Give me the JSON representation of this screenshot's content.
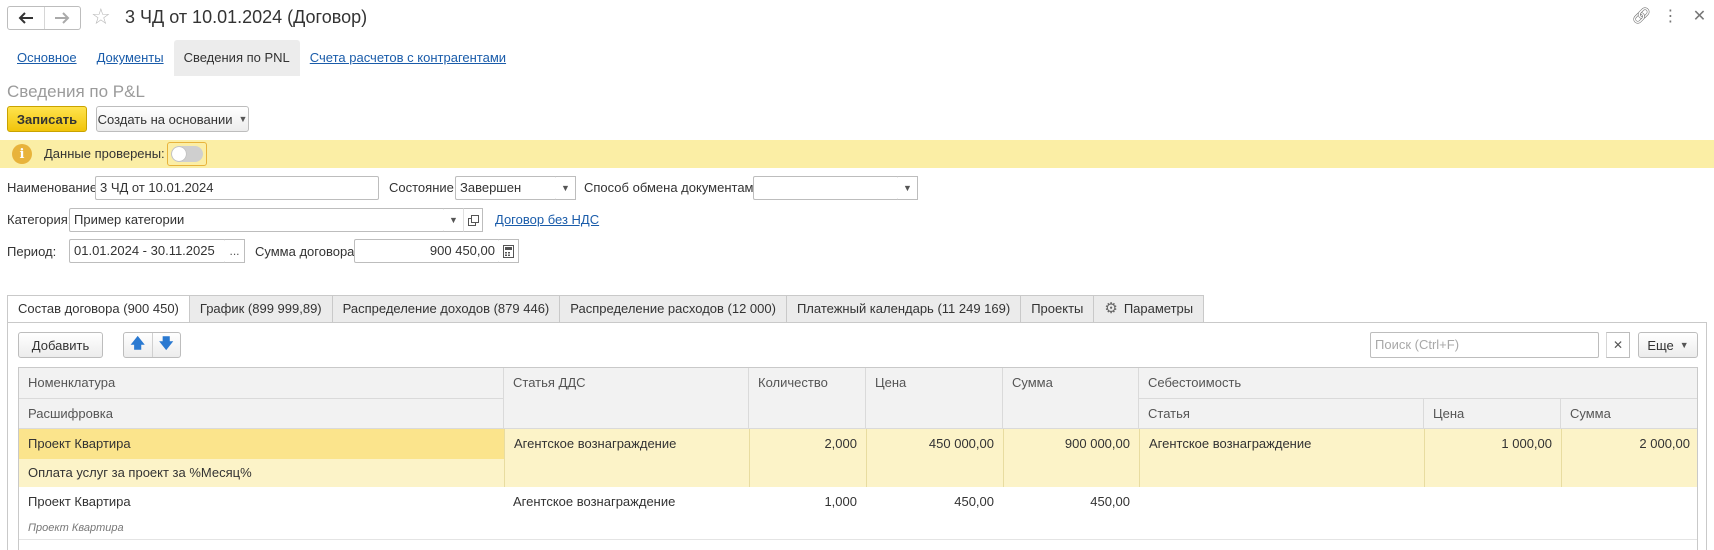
{
  "window": {
    "title": "3 ЧД от 10.01.2024 (Договор)"
  },
  "subtabs": [
    "Основное",
    "Документы",
    "Сведения по PNL",
    "Счета расчетов с контрагентами"
  ],
  "section_title": "Сведения по P&L",
  "toolbar": {
    "save_label": "Записать",
    "create_based_label": "Создать на основании"
  },
  "info": {
    "label": "Данные проверены:",
    "checked": false
  },
  "form": {
    "name_label": "Наименование:",
    "name_value": "3 ЧД от 10.01.2024",
    "state_label": "Состояние:",
    "state_value": "Завершен",
    "exchange_label": "Способ обмена документами:",
    "exchange_value": "",
    "category_label": "Категория:",
    "category_value": "Пример категории",
    "vat_link": "Договор без НДС",
    "period_label": "Период:",
    "period_value": "01.01.2024 - 30.11.2025",
    "period_btn": "...",
    "sum_label": "Сумма договора:",
    "sum_value": "900 450,00"
  },
  "tabs": [
    "Состав договора (900 450)",
    "График (899 999,89)",
    "Распределение доходов (879 446)",
    "Распределение расходов (12 000)",
    "Платежный календарь (11 249 169)",
    "Проекты",
    "Параметры"
  ],
  "table_toolbar": {
    "add_label": "Добавить",
    "search_placeholder": "Поиск (Ctrl+F)",
    "more_label": "Еще"
  },
  "table": {
    "headers": {
      "nomenclature": "Номенклатура",
      "decoding": "Расшифровка",
      "dds": "Статья ДДС",
      "qty": "Количество",
      "price": "Цена",
      "sum": "Сумма",
      "cost": "Себестоимость",
      "cost_item": "Статья",
      "cost_price": "Цена",
      "cost_sum": "Сумма"
    },
    "rows": [
      {
        "nomenclature": "Проект Квартира",
        "decoding": "Оплата услуг за проект за %Месяц%",
        "dds": "Агентское вознаграждение",
        "qty": "2,000",
        "price": "450 000,00",
        "sum": "900 000,00",
        "cost_item": "Агентское вознаграждение",
        "cost_price": "1 000,00",
        "cost_sum": "2 000,00"
      },
      {
        "nomenclature": "Проект Квартира",
        "decoding": "Проект Квартира",
        "dds": "Агентское вознаграждение",
        "qty": "1,000",
        "price": "450,00",
        "sum": "450,00",
        "cost_item": "",
        "cost_price": "",
        "cost_sum": ""
      }
    ]
  },
  "icons": [
    "arrow-left-icon",
    "arrow-right-icon",
    "star-icon",
    "link-icon",
    "more-vert-icon",
    "close-icon",
    "info-icon",
    "gear-icon",
    "arrow-up-icon",
    "arrow-down-icon",
    "calculator-icon",
    "open-icon"
  ]
}
